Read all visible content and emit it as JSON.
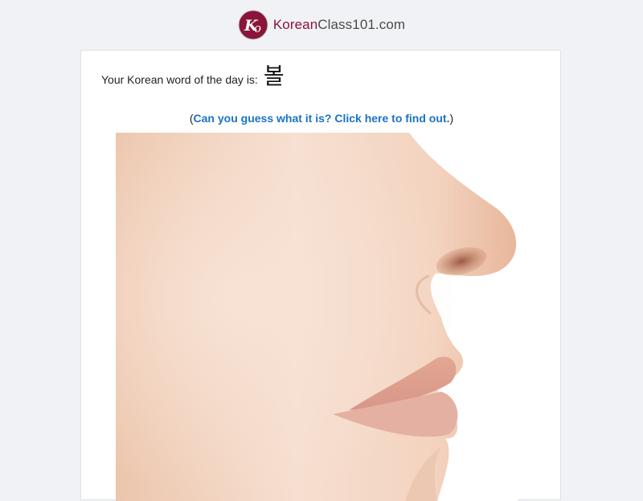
{
  "header": {
    "logo_icon": "ko-logo-icon",
    "brand_part": "Korean",
    "rest_part": "Class101.com",
    "brand_color": "#8a1538"
  },
  "content": {
    "wod_label": "Your Korean word of the day is:",
    "wod_word": "볼",
    "guess_open": "(",
    "guess_link": "Can you guess what it is? Click here to find out.",
    "guess_close": ")",
    "link_color": "#1a73c6",
    "image_subject": "cheek-photo"
  }
}
